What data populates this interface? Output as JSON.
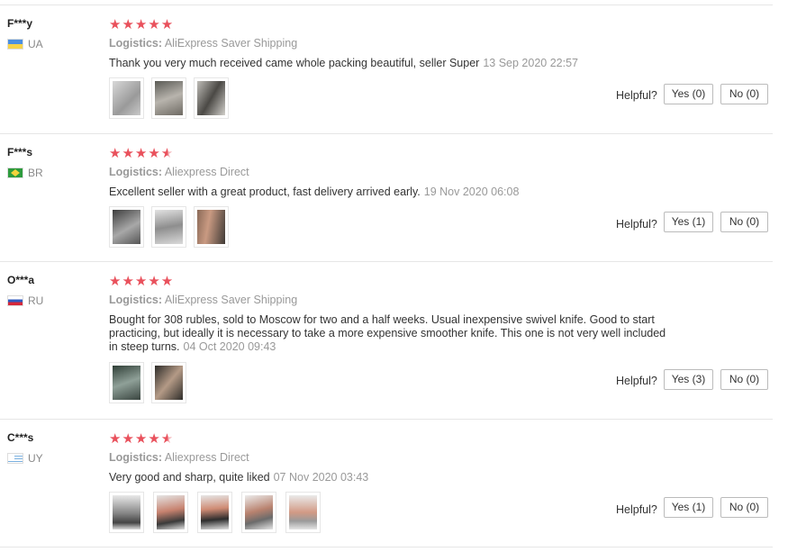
{
  "helpful_label": "Helpful?",
  "reviews": [
    {
      "user": "F***y",
      "country": "UA",
      "rating": 5,
      "stars": "★★★★★",
      "logistics_label": "Logistics:",
      "logistics": "AliExpress Saver Shipping",
      "text": "Thank you very much received came whole packing beautiful, seller Super",
      "date": "13 Sep 2020 22:57",
      "photos": 3,
      "yes": "Yes (0)",
      "no": "No (0)"
    },
    {
      "user": "F***s",
      "country": "BR",
      "rating": 4.5,
      "stars": "★★★★",
      "stars_half": "★",
      "logistics_label": "Logistics:",
      "logistics": "Aliexpress Direct",
      "text": "Excellent seller with a great product, fast delivery arrived early.",
      "date": "19 Nov 2020 06:08",
      "photos": 3,
      "yes": "Yes (1)",
      "no": "No (0)"
    },
    {
      "user": "O***a",
      "country": "RU",
      "rating": 5,
      "stars": "★★★★★",
      "logistics_label": "Logistics:",
      "logistics": "AliExpress Saver Shipping",
      "text": "Bought for 308 rubles, sold to Moscow for two and a half weeks. Usual inexpensive swivel knife. Good to start practicing, but ideally it is necessary to take a more expensive smoother knife. This one is not very well included in steep turns.",
      "date": "04 Oct 2020 09:43",
      "photos": 2,
      "yes": "Yes (3)",
      "no": "No (0)"
    },
    {
      "user": "C***s",
      "country": "UY",
      "rating": 4.5,
      "stars": "★★★★",
      "stars_half": "★",
      "logistics_label": "Logistics:",
      "logistics": "Aliexpress Direct",
      "text": "Very good and sharp, quite liked",
      "date": "07 Nov 2020 03:43",
      "photos": 5,
      "yes": "Yes (1)",
      "no": "No (0)"
    }
  ]
}
